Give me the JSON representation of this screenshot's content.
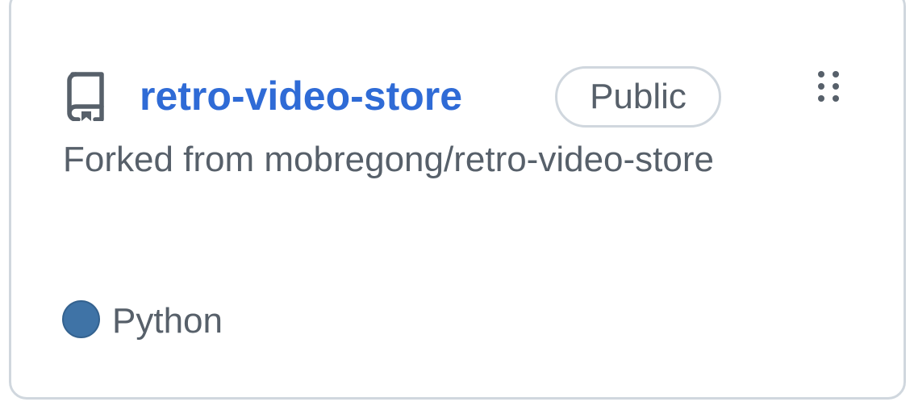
{
  "repo": {
    "name": "retro-video-store",
    "visibility": "Public",
    "forked_from": "Forked from mobregong/retro-video-store",
    "language": {
      "name": "Python",
      "color": "#3f73a6"
    }
  },
  "colors": {
    "link": "#2f6bd6",
    "muted_text": "#57606a",
    "border": "#d0d7de"
  },
  "icons": {
    "repo": "repo-icon",
    "drag": "grabber-icon"
  }
}
